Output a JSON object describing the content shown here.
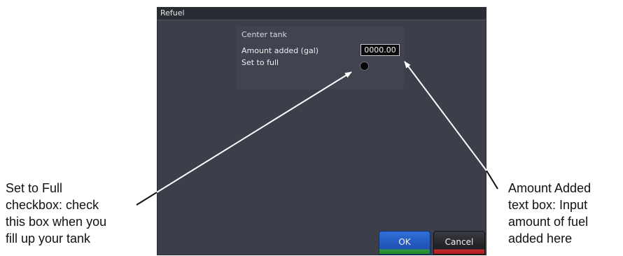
{
  "dialog": {
    "title": "Refuel",
    "group": {
      "label": "Center tank",
      "amount_label": "Amount added (gal)",
      "amount_value": "0000.00",
      "full_label": "Set to full"
    },
    "buttons": {
      "ok_label": "OK",
      "cancel_label": "Cancel"
    }
  },
  "annotations": {
    "set_to_full": [
      "Set to Full",
      "checkbox: check",
      "this box when you",
      "fill up your tank"
    ],
    "amount_added": [
      "Amount Added",
      "text box: Input",
      "amount of fuel",
      "added here"
    ]
  },
  "colors": {
    "dialog_bg": "#3c3f49",
    "ok_accent": "#1f4fb0",
    "cancel_accent": "#c62a2a"
  }
}
